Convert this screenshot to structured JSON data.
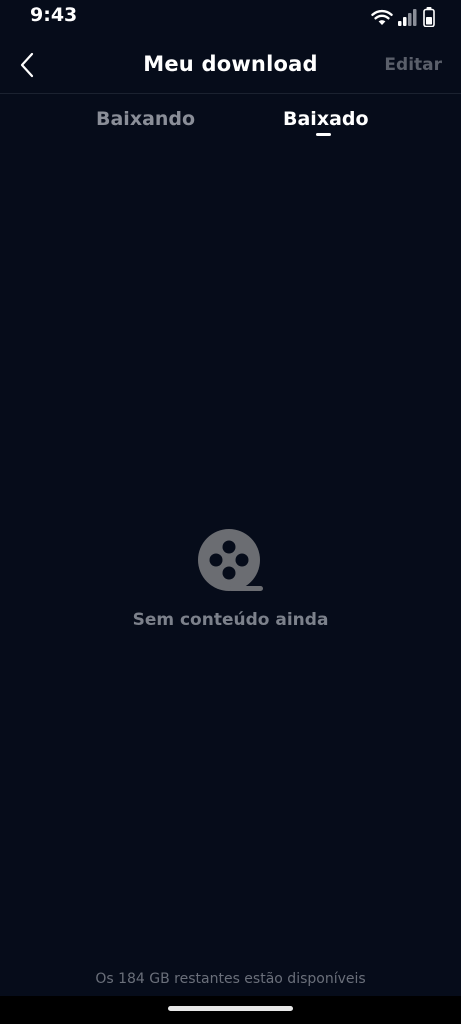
{
  "status_bar": {
    "time": "9:43",
    "icons": [
      "wifi-icon",
      "signal-icon",
      "battery-icon"
    ]
  },
  "header": {
    "back_icon": "chevron-left-icon",
    "title": "Meu download",
    "edit_label": "Editar"
  },
  "tabs": [
    {
      "label": "Baixando",
      "active": false
    },
    {
      "label": "Baixado",
      "active": true
    }
  ],
  "empty_state": {
    "icon": "film-reel-icon",
    "text": "Sem conteúdo ainda"
  },
  "footer": {
    "storage_text": "Os 184 GB restantes estão disponíveis"
  },
  "colors": {
    "background": "#060c1a",
    "text_primary": "#ffffff",
    "text_muted": "#7c818b",
    "icon_muted": "#6b6d72"
  }
}
